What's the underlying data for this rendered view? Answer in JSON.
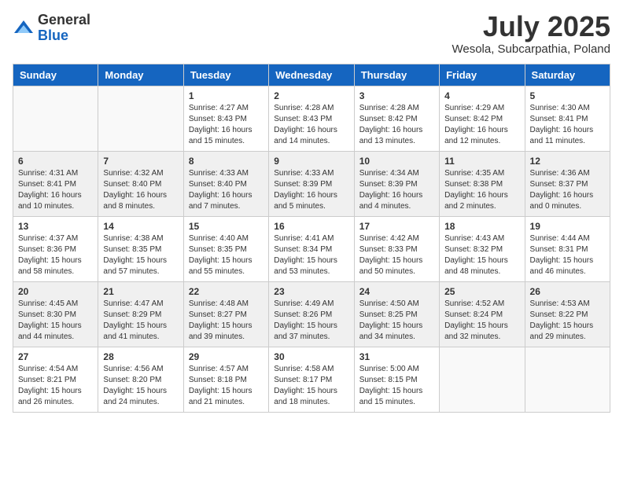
{
  "header": {
    "logo_general": "General",
    "logo_blue": "Blue",
    "month_title": "July 2025",
    "location": "Wesola, Subcarpathia, Poland"
  },
  "days_of_week": [
    "Sunday",
    "Monday",
    "Tuesday",
    "Wednesday",
    "Thursday",
    "Friday",
    "Saturday"
  ],
  "weeks": [
    [
      {
        "day": "",
        "info": ""
      },
      {
        "day": "",
        "info": ""
      },
      {
        "day": "1",
        "info": "Sunrise: 4:27 AM\nSunset: 8:43 PM\nDaylight: 16 hours and 15 minutes."
      },
      {
        "day": "2",
        "info": "Sunrise: 4:28 AM\nSunset: 8:43 PM\nDaylight: 16 hours and 14 minutes."
      },
      {
        "day": "3",
        "info": "Sunrise: 4:28 AM\nSunset: 8:42 PM\nDaylight: 16 hours and 13 minutes."
      },
      {
        "day": "4",
        "info": "Sunrise: 4:29 AM\nSunset: 8:42 PM\nDaylight: 16 hours and 12 minutes."
      },
      {
        "day": "5",
        "info": "Sunrise: 4:30 AM\nSunset: 8:41 PM\nDaylight: 16 hours and 11 minutes."
      }
    ],
    [
      {
        "day": "6",
        "info": "Sunrise: 4:31 AM\nSunset: 8:41 PM\nDaylight: 16 hours and 10 minutes."
      },
      {
        "day": "7",
        "info": "Sunrise: 4:32 AM\nSunset: 8:40 PM\nDaylight: 16 hours and 8 minutes."
      },
      {
        "day": "8",
        "info": "Sunrise: 4:33 AM\nSunset: 8:40 PM\nDaylight: 16 hours and 7 minutes."
      },
      {
        "day": "9",
        "info": "Sunrise: 4:33 AM\nSunset: 8:39 PM\nDaylight: 16 hours and 5 minutes."
      },
      {
        "day": "10",
        "info": "Sunrise: 4:34 AM\nSunset: 8:39 PM\nDaylight: 16 hours and 4 minutes."
      },
      {
        "day": "11",
        "info": "Sunrise: 4:35 AM\nSunset: 8:38 PM\nDaylight: 16 hours and 2 minutes."
      },
      {
        "day": "12",
        "info": "Sunrise: 4:36 AM\nSunset: 8:37 PM\nDaylight: 16 hours and 0 minutes."
      }
    ],
    [
      {
        "day": "13",
        "info": "Sunrise: 4:37 AM\nSunset: 8:36 PM\nDaylight: 15 hours and 58 minutes."
      },
      {
        "day": "14",
        "info": "Sunrise: 4:38 AM\nSunset: 8:35 PM\nDaylight: 15 hours and 57 minutes."
      },
      {
        "day": "15",
        "info": "Sunrise: 4:40 AM\nSunset: 8:35 PM\nDaylight: 15 hours and 55 minutes."
      },
      {
        "day": "16",
        "info": "Sunrise: 4:41 AM\nSunset: 8:34 PM\nDaylight: 15 hours and 53 minutes."
      },
      {
        "day": "17",
        "info": "Sunrise: 4:42 AM\nSunset: 8:33 PM\nDaylight: 15 hours and 50 minutes."
      },
      {
        "day": "18",
        "info": "Sunrise: 4:43 AM\nSunset: 8:32 PM\nDaylight: 15 hours and 48 minutes."
      },
      {
        "day": "19",
        "info": "Sunrise: 4:44 AM\nSunset: 8:31 PM\nDaylight: 15 hours and 46 minutes."
      }
    ],
    [
      {
        "day": "20",
        "info": "Sunrise: 4:45 AM\nSunset: 8:30 PM\nDaylight: 15 hours and 44 minutes."
      },
      {
        "day": "21",
        "info": "Sunrise: 4:47 AM\nSunset: 8:29 PM\nDaylight: 15 hours and 41 minutes."
      },
      {
        "day": "22",
        "info": "Sunrise: 4:48 AM\nSunset: 8:27 PM\nDaylight: 15 hours and 39 minutes."
      },
      {
        "day": "23",
        "info": "Sunrise: 4:49 AM\nSunset: 8:26 PM\nDaylight: 15 hours and 37 minutes."
      },
      {
        "day": "24",
        "info": "Sunrise: 4:50 AM\nSunset: 8:25 PM\nDaylight: 15 hours and 34 minutes."
      },
      {
        "day": "25",
        "info": "Sunrise: 4:52 AM\nSunset: 8:24 PM\nDaylight: 15 hours and 32 minutes."
      },
      {
        "day": "26",
        "info": "Sunrise: 4:53 AM\nSunset: 8:22 PM\nDaylight: 15 hours and 29 minutes."
      }
    ],
    [
      {
        "day": "27",
        "info": "Sunrise: 4:54 AM\nSunset: 8:21 PM\nDaylight: 15 hours and 26 minutes."
      },
      {
        "day": "28",
        "info": "Sunrise: 4:56 AM\nSunset: 8:20 PM\nDaylight: 15 hours and 24 minutes."
      },
      {
        "day": "29",
        "info": "Sunrise: 4:57 AM\nSunset: 8:18 PM\nDaylight: 15 hours and 21 minutes."
      },
      {
        "day": "30",
        "info": "Sunrise: 4:58 AM\nSunset: 8:17 PM\nDaylight: 15 hours and 18 minutes."
      },
      {
        "day": "31",
        "info": "Sunrise: 5:00 AM\nSunset: 8:15 PM\nDaylight: 15 hours and 15 minutes."
      },
      {
        "day": "",
        "info": ""
      },
      {
        "day": "",
        "info": ""
      }
    ]
  ]
}
